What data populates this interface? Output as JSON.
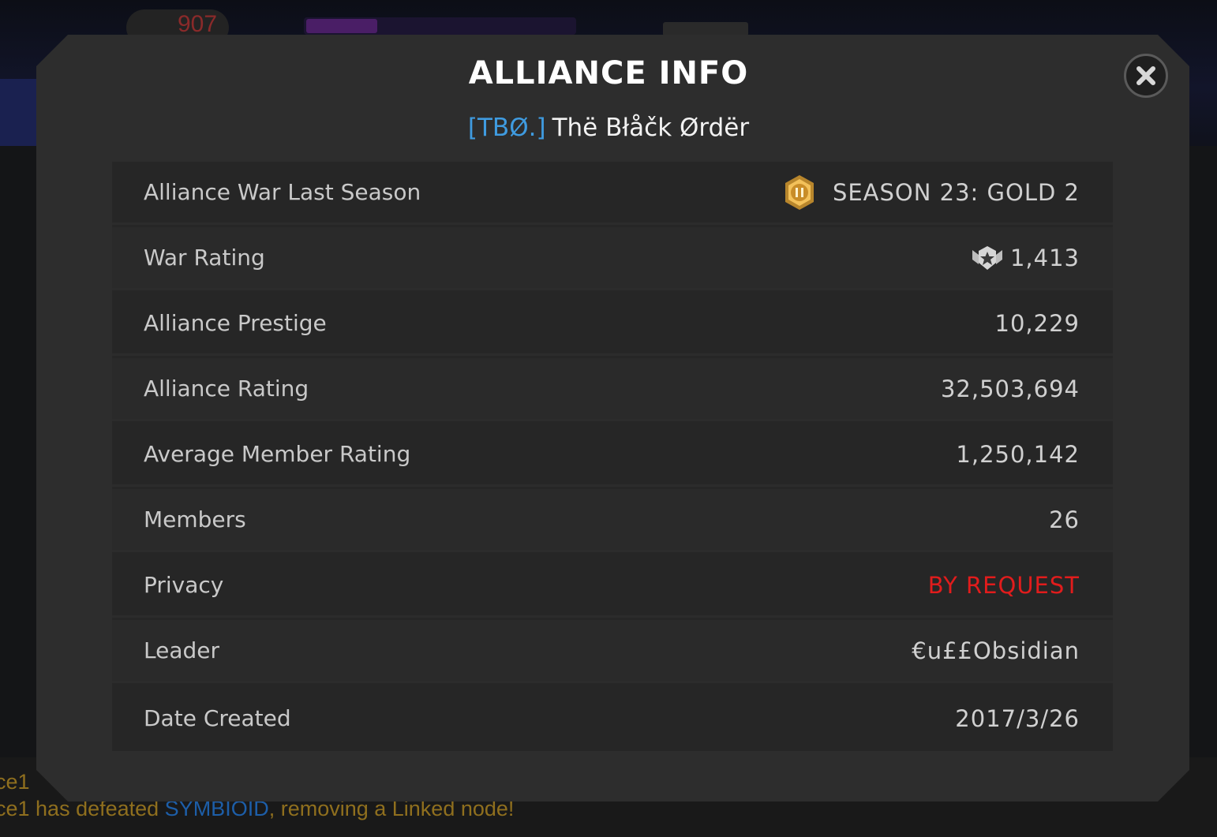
{
  "background": {
    "top_stat": "907",
    "feed_lines": [
      {
        "prefix": "ce1",
        "highlight": "",
        "suffix": ""
      },
      {
        "prefix": "ce1 has defeated ",
        "highlight": "SYMBIOID",
        "suffix": ", removing a Linked node!"
      }
    ]
  },
  "modal": {
    "title": "ALLIANCE INFO",
    "alliance_tag": "[TBØ.]",
    "alliance_name": "Thë Błåčk Ørdër",
    "close_icon": "close-icon",
    "rows": [
      {
        "label": "Alliance War Last Season",
        "value": "SEASON 23: GOLD 2",
        "icon": "gold-badge-icon"
      },
      {
        "label": "War Rating",
        "value": "1,413",
        "icon": "war-rating-icon"
      },
      {
        "label": "Alliance Prestige",
        "value": "10,229"
      },
      {
        "label": "Alliance Rating",
        "value": "32,503,694"
      },
      {
        "label": "Average Member Rating",
        "value": "1,250,142"
      },
      {
        "label": "Members",
        "value": "26"
      },
      {
        "label": "Privacy",
        "value": "BY REQUEST"
      },
      {
        "label": "Leader",
        "value": "€u££Obsidian"
      },
      {
        "label": "Date Created",
        "value": "2017/3/26"
      }
    ]
  },
  "colors": {
    "tag_blue": "#3f9be0",
    "privacy_red": "#e11c1c",
    "feed_gold": "#8f6f1e",
    "feed_blue": "#1d5ea8"
  }
}
